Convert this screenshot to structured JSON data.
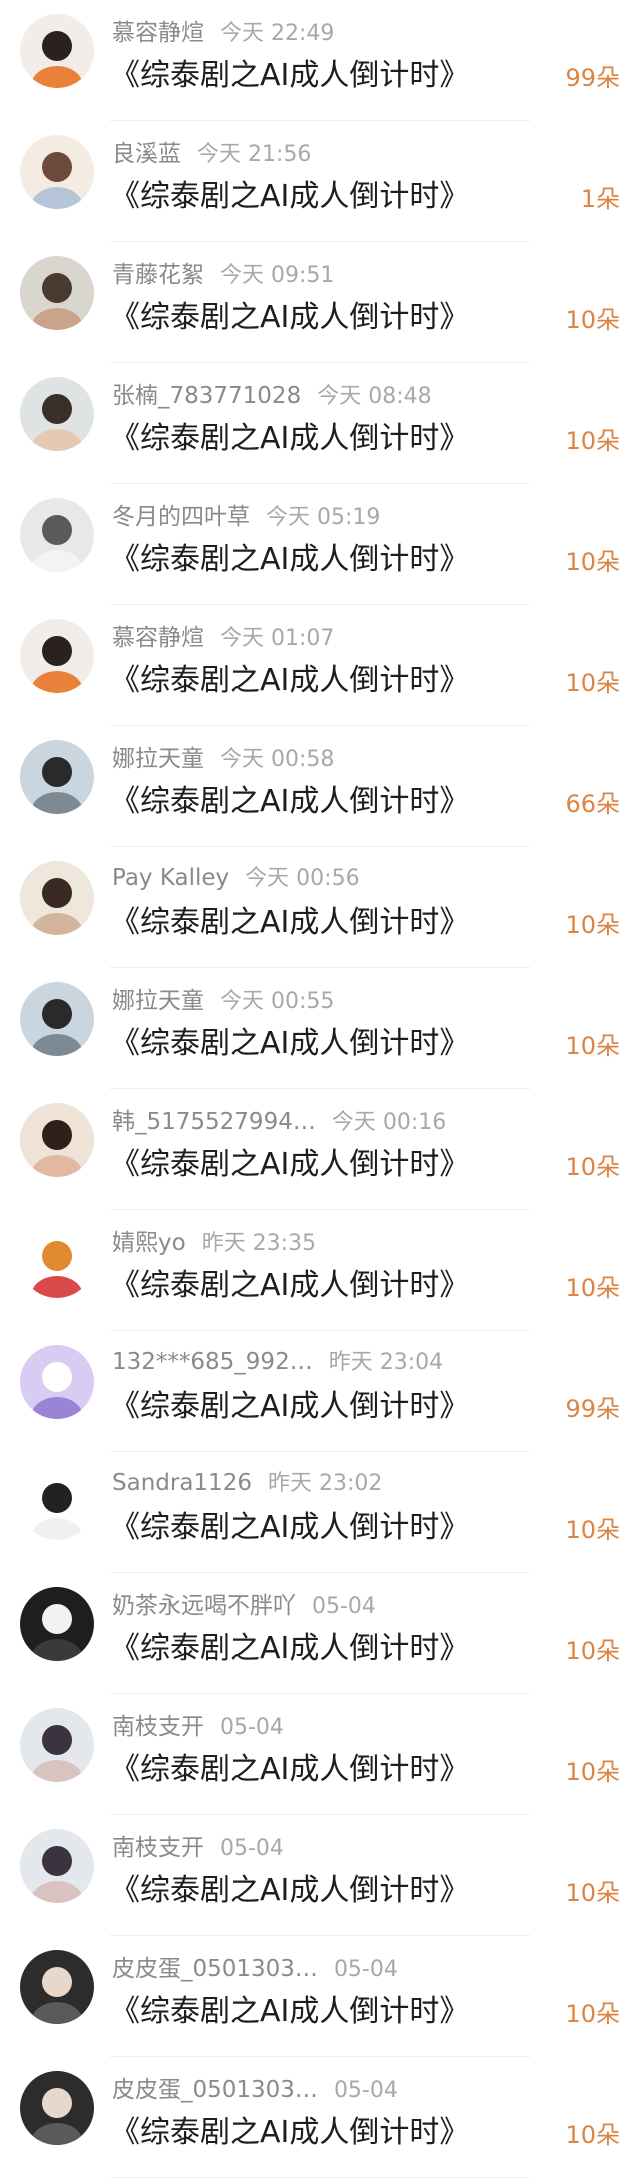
{
  "records": [
    {
      "name": "慕容静煊",
      "time": "今天 22:49",
      "title": "《综泰剧之AI成人倒计时》",
      "count": "99朵",
      "avatar_colors": [
        "#f2ede8",
        "#2b2220",
        "#e9813a"
      ]
    },
    {
      "name": "良溪蓝",
      "time": "今天 21:56",
      "title": "《综泰剧之AI成人倒计时》",
      "count": "1朵",
      "avatar_colors": [
        "#f4ece2",
        "#6d4a3a",
        "#b5c4d6"
      ]
    },
    {
      "name": "青藤花絮",
      "time": "今天 09:51",
      "title": "《综泰剧之AI成人倒计时》",
      "count": "10朵",
      "avatar_colors": [
        "#d9d6cd",
        "#4a3b32",
        "#c9a48a"
      ]
    },
    {
      "name": "张楠_783771028",
      "time": "今天 08:48",
      "title": "《综泰剧之AI成人倒计时》",
      "count": "10朵",
      "avatar_colors": [
        "#dfe3e2",
        "#3a2e2a",
        "#e6c9b5"
      ]
    },
    {
      "name": "冬月的四叶草",
      "time": "今天 05:19",
      "title": "《综泰剧之AI成人倒计时》",
      "count": "10朵",
      "avatar_colors": [
        "#e8e8e8",
        "#5a5a5a",
        "#f3f3f3"
      ]
    },
    {
      "name": "慕容静煊",
      "time": "今天 01:07",
      "title": "《综泰剧之AI成人倒计时》",
      "count": "10朵",
      "avatar_colors": [
        "#f2ede8",
        "#2b2220",
        "#e9813a"
      ]
    },
    {
      "name": "娜拉天童",
      "time": "今天 00:58",
      "title": "《综泰剧之AI成人倒计时》",
      "count": "66朵",
      "avatar_colors": [
        "#c9d6e0",
        "#2a2a2a",
        "#7e8a93"
      ]
    },
    {
      "name": "Pay Kalley",
      "time": "今天 00:56",
      "title": "《综泰剧之AI成人倒计时》",
      "count": "10朵",
      "avatar_colors": [
        "#efe6dc",
        "#3b2a24",
        "#d3b49c"
      ]
    },
    {
      "name": "娜拉天童",
      "time": "今天 00:55",
      "title": "《综泰剧之AI成人倒计时》",
      "count": "10朵",
      "avatar_colors": [
        "#c9d6e0",
        "#2a2a2a",
        "#7e8a93"
      ]
    },
    {
      "name": "韩_5175527994…",
      "time": "今天 00:16",
      "title": "《综泰剧之AI成人倒计时》",
      "count": "10朵",
      "avatar_colors": [
        "#efe2d6",
        "#2e211c",
        "#e3b8a0"
      ]
    },
    {
      "name": "婧熙yo",
      "time": "昨天 23:35",
      "title": "《综泰剧之AI成人倒计时》",
      "count": "10朵",
      "avatar_colors": [
        "#ffffff",
        "#e0892f",
        "#d94b4b"
      ]
    },
    {
      "name": "132***685_992…",
      "time": "昨天 23:04",
      "title": "《综泰剧之AI成人倒计时》",
      "count": "99朵",
      "avatar_colors": [
        "#d9ccf3",
        "#ffffff",
        "#9a84d6"
      ]
    },
    {
      "name": "Sandra1126",
      "time": "昨天 23:02",
      "title": "《综泰剧之AI成人倒计时》",
      "count": "10朵",
      "avatar_colors": [
        "#ffffff",
        "#222222",
        "#f0f0f0"
      ]
    },
    {
      "name": "奶茶永远喝不胖吖",
      "time": "05-04",
      "title": "《综泰剧之AI成人倒计时》",
      "count": "10朵",
      "avatar_colors": [
        "#1e1e1e",
        "#f2f2f2",
        "#3a3a3a"
      ]
    },
    {
      "name": "南枝支开",
      "time": "05-04",
      "title": "《综泰剧之AI成人倒计时》",
      "count": "10朵",
      "avatar_colors": [
        "#e4e7ec",
        "#3a3340",
        "#d8c3c0"
      ]
    },
    {
      "name": "南枝支开",
      "time": "05-04",
      "title": "《综泰剧之AI成人倒计时》",
      "count": "10朵",
      "avatar_colors": [
        "#e4e7ec",
        "#3a3340",
        "#d8c3c0"
      ]
    },
    {
      "name": "皮皮蛋_0501303…",
      "time": "05-04",
      "title": "《综泰剧之AI成人倒计时》",
      "count": "10朵",
      "avatar_colors": [
        "#2c2c2c",
        "#e8d8cc",
        "#5a5a5a"
      ]
    },
    {
      "name": "皮皮蛋_0501303…",
      "time": "05-04",
      "title": "《综泰剧之AI成人倒计时》",
      "count": "10朵",
      "avatar_colors": [
        "#2c2c2c",
        "#e8d8cc",
        "#5a5a5a"
      ]
    }
  ]
}
